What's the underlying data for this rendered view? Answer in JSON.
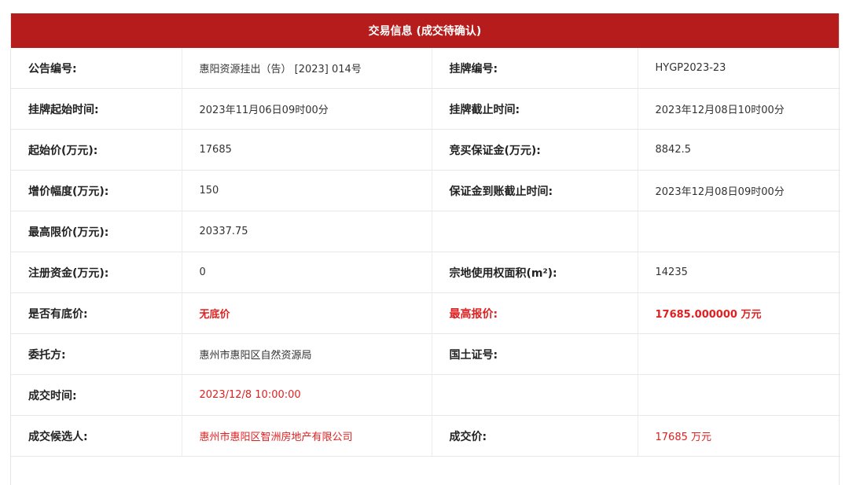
{
  "header": {
    "title": "交易信息 (成交待确认)"
  },
  "rows": [
    {
      "l1": "公告编号:",
      "v1": "惠阳资源挂出（告） [2023] 014号",
      "l2": "挂牌编号:",
      "v2": "HYGP2023-23"
    },
    {
      "l1": "挂牌起始时间:",
      "v1": "2023年11月06日09时00分",
      "l2": "挂牌截止时间:",
      "v2": "2023年12月08日10时00分"
    },
    {
      "l1": "起始价(万元):",
      "v1": "17685",
      "l2": "竞买保证金(万元):",
      "v2": "8842.5"
    },
    {
      "l1": "增价幅度(万元):",
      "v1": "150",
      "l2": "保证金到账截止时间:",
      "v2": "2023年12月08日09时00分"
    },
    {
      "l1": "最高限价(万元):",
      "v1": "20337.75",
      "l2": "",
      "v2": ""
    },
    {
      "l1": "注册资金(万元):",
      "v1": "0",
      "l2": "宗地使用权面积(m²):",
      "v2": "14235"
    },
    {
      "l1": "是否有底价:",
      "v1": "无底价",
      "l2": "最高报价:",
      "v2": "17685.000000 万元"
    },
    {
      "l1": "委托方:",
      "v1": "惠州市惠阳区自然资源局",
      "l2": "国土证号:",
      "v2": ""
    },
    {
      "l1": "成交时间:",
      "v1": "2023/12/8 10:00:00",
      "l2": "",
      "v2": ""
    },
    {
      "l1": "成交候选人:",
      "v1": "惠州市惠阳区智洲房地产有限公司",
      "l2": "成交价:",
      "v2": "17685 万元"
    }
  ],
  "colors": {
    "header_bg": "#b71c1c",
    "highlight": "#e02020"
  }
}
